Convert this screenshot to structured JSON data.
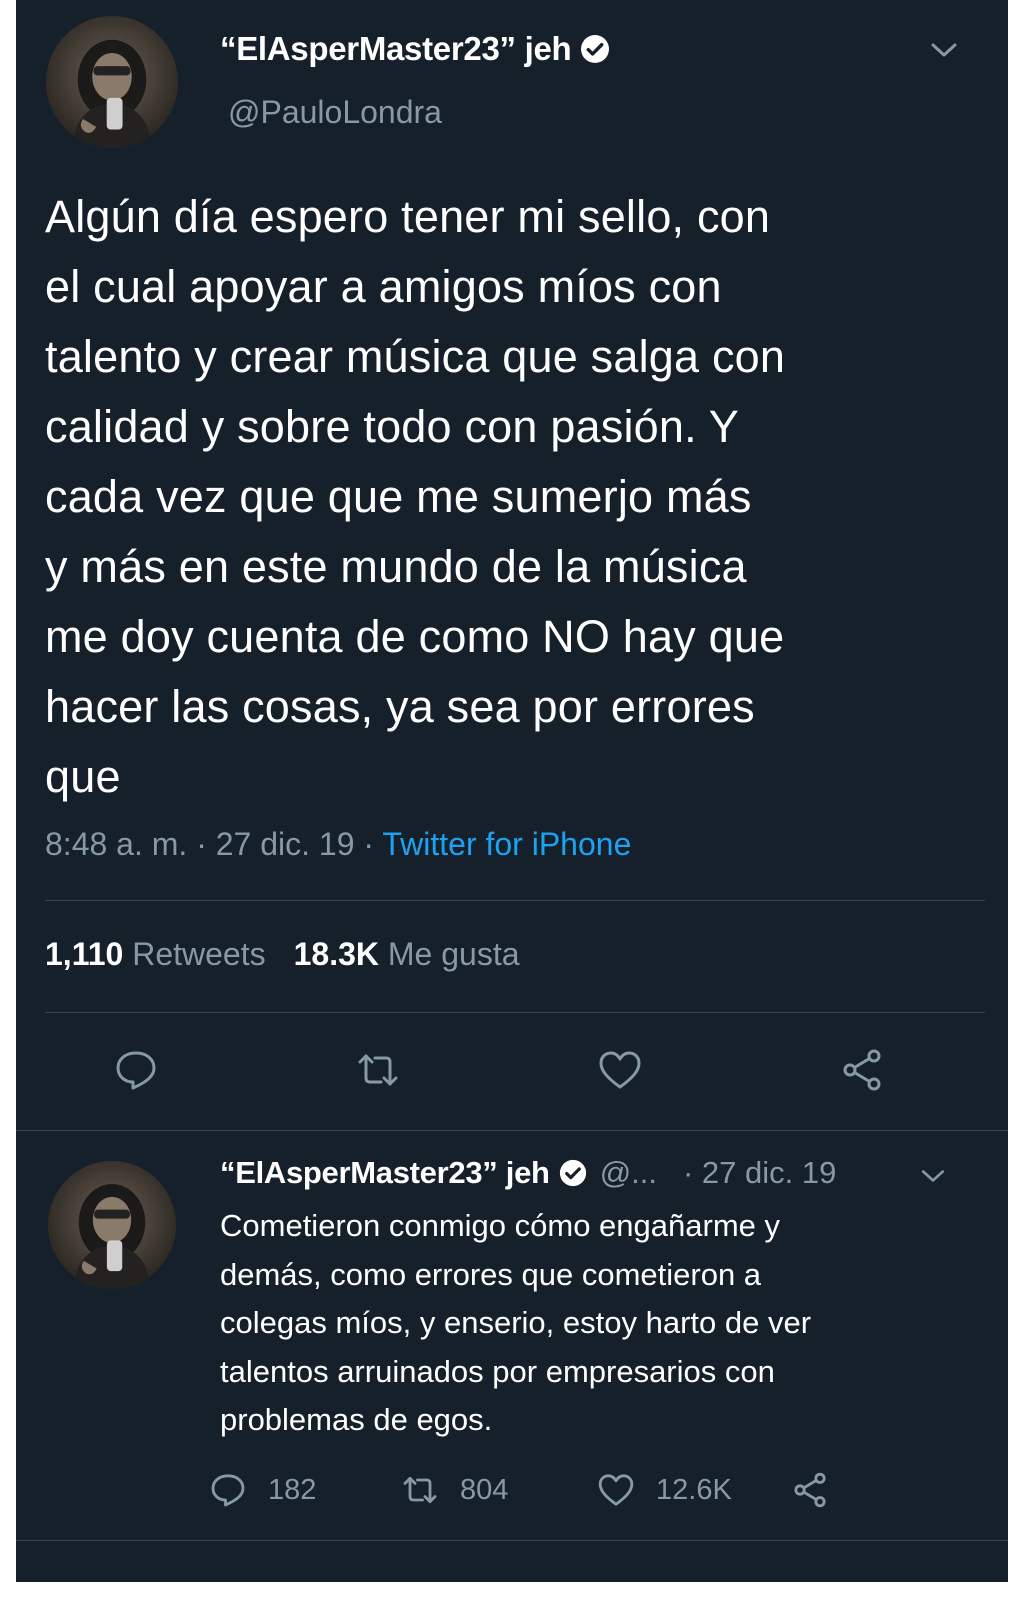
{
  "tweet": {
    "author": {
      "display_name": "“ElAsperMaster23” jeh",
      "handle": "@PauloLondra",
      "verified": true,
      "avatar_icon": "avatar-photo"
    },
    "text": "Algún día espero tener mi sello, con\nel cual apoyar a amigos míos con\ntalento y crear música que salga con\ncalidad y sobre todo con pasión. Y\ncada vez que que me sumerjo más\ny más en este mundo de la música\nme doy cuenta de como NO hay que\nhacer las cosas, ya sea por errores\nque",
    "time": "8:48 a. m.",
    "date": "27 dic. 19",
    "separator": "·",
    "source": "Twitter for iPhone",
    "retweets_count": "1,110",
    "retweets_label": "Retweets",
    "likes_count": "18.3K",
    "likes_label": "Me gusta",
    "actions": [
      "reply-icon",
      "retweet-icon",
      "like-icon",
      "share-icon"
    ]
  },
  "reply": {
    "author": {
      "display_name": "“ElAsperMaster23” jeh",
      "handle": "@...",
      "verified": true
    },
    "date": "· 27 dic. 19",
    "text": "Cometieron conmigo cómo engañarme y\ndemás, como errores que cometieron a\ncolegas míos, y enserio, estoy harto de ver\ntalentos arruinados por empresarios con\nproblemas de egos.",
    "replies_count": "182",
    "retweets_count": "804",
    "likes_count": "12.6K"
  },
  "colors": {
    "background": "#15202b",
    "text": "#ffffff",
    "muted": "#8899a6",
    "link": "#1da1f2",
    "divider": "#38444d"
  }
}
